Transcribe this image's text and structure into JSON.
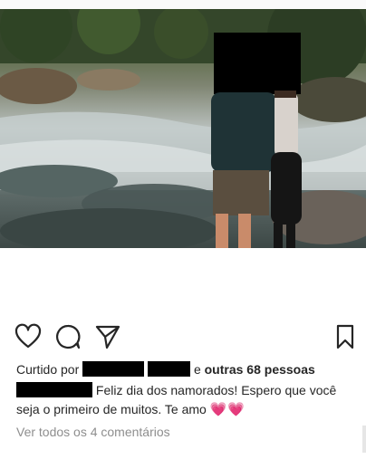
{
  "post": {
    "likes_prefix": "Curtido por",
    "likes_joiner": "e",
    "likes_others": "outras 68 pessoas",
    "caption_text": "Feliz dia dos namorados! Espero que você seja o primeiro de muitos. Te amo",
    "caption_emoji": "💗💗",
    "view_comments": "Ver todos os 4 comentários"
  },
  "icons": {
    "like": "heart-icon",
    "comment": "comment-icon",
    "share": "send-icon",
    "save": "bookmark-icon"
  },
  "colors": {
    "text": "#262626",
    "muted": "#8e8e8e",
    "heart_emoji": "#d8517e",
    "censor": "#000000"
  }
}
